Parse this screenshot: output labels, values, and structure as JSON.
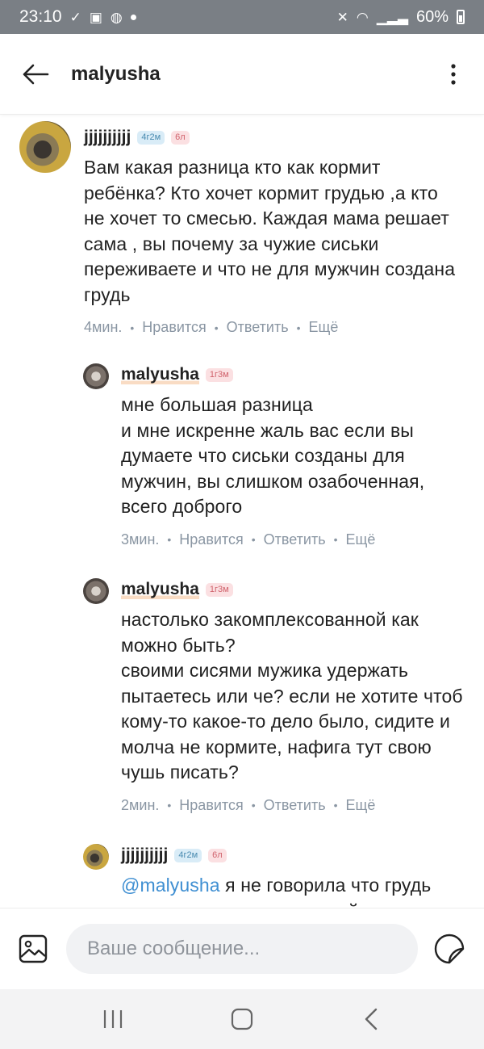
{
  "status_bar": {
    "time": "23:10",
    "battery": "60%"
  },
  "header": {
    "title": "malyusha"
  },
  "comments": [
    {
      "username": "jjjjjjjjjj",
      "badge1": "4г2м",
      "badge2": "6л",
      "text": "Вам какая разница кто как кормит ребёнка? Кто хочет кормит грудью ,а кто не хочет то смесью. Каждая мама решает сама , вы почему за чужие сиськи переживаете и что не для мужчин создана грудь",
      "time": "4мин.",
      "like": "Нравится",
      "reply": "Ответить",
      "more": "Ещё"
    },
    {
      "username": "malyusha",
      "badge1": "1г3м",
      "text": "мне большая разница\nи мне искренне жаль вас если вы думаете что сиськи созданы для мужчин, вы слишком озабоченная, всего доброго",
      "time": "3мин.",
      "like": "Нравится",
      "reply": "Ответить",
      "more": "Ещё"
    },
    {
      "username": "malyusha",
      "badge1": "1г3м",
      "text": "настолько закомплексованной как можно быть?\nсвоими сисями мужика удержать пытаетесь или че? если не хотите чтоб кому-то какое-то дело было, сидите и молча не кормите, нафига тут свою чушь писать?",
      "time": "2мин.",
      "like": "Нравится",
      "reply": "Ответить",
      "more": "Ещё"
    },
    {
      "username": "jjjjjjjjjj",
      "badge1": "4г2м",
      "badge2": "6л",
      "mention": "@malyusha",
      "text": " я не говорила что грудь создана для мужчин, читайте"
    }
  ],
  "composer": {
    "placeholder": "Ваше сообщение..."
  },
  "colors": {
    "mention": "#3f8fd2",
    "meta": "#8a96a3",
    "badge_blue": "#d9ecf7",
    "badge_red": "#fbe0e2"
  },
  "icons": [
    "back-arrow-icon",
    "more-vertical-icon",
    "image-icon",
    "sticker-icon",
    "recent-apps-icon",
    "home-icon",
    "back-nav-icon"
  ]
}
